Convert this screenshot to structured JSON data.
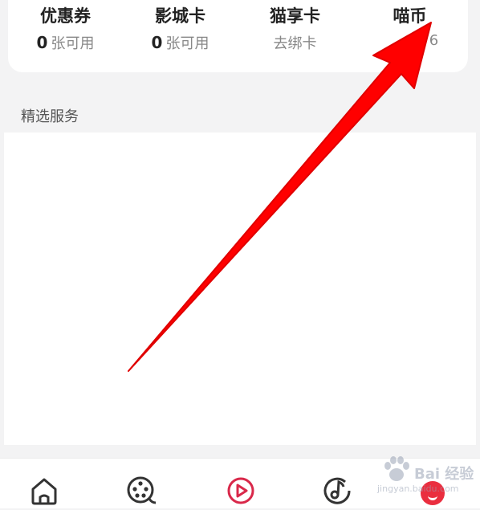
{
  "assets": [
    {
      "title": "优惠券",
      "count": "0",
      "unit": "张可用"
    },
    {
      "title": "影城卡",
      "count": "0",
      "unit": "张可用"
    },
    {
      "title": "猫享卡",
      "count": "",
      "unit": "去绑卡"
    },
    {
      "title": "喵币",
      "count": "",
      "unit": "6"
    }
  ],
  "services": {
    "heading": "精选服务"
  },
  "nav": [
    {
      "name": "home-icon"
    },
    {
      "name": "cinema-icon"
    },
    {
      "name": "video-play-icon"
    },
    {
      "name": "music-icon"
    },
    {
      "name": "profile-icon"
    }
  ],
  "watermark": {
    "brand": "Bai 经验",
    "url": "jingyan.baidu.com"
  },
  "colors": {
    "accent": "#ea2e3f",
    "arrow": "#ff0000"
  }
}
